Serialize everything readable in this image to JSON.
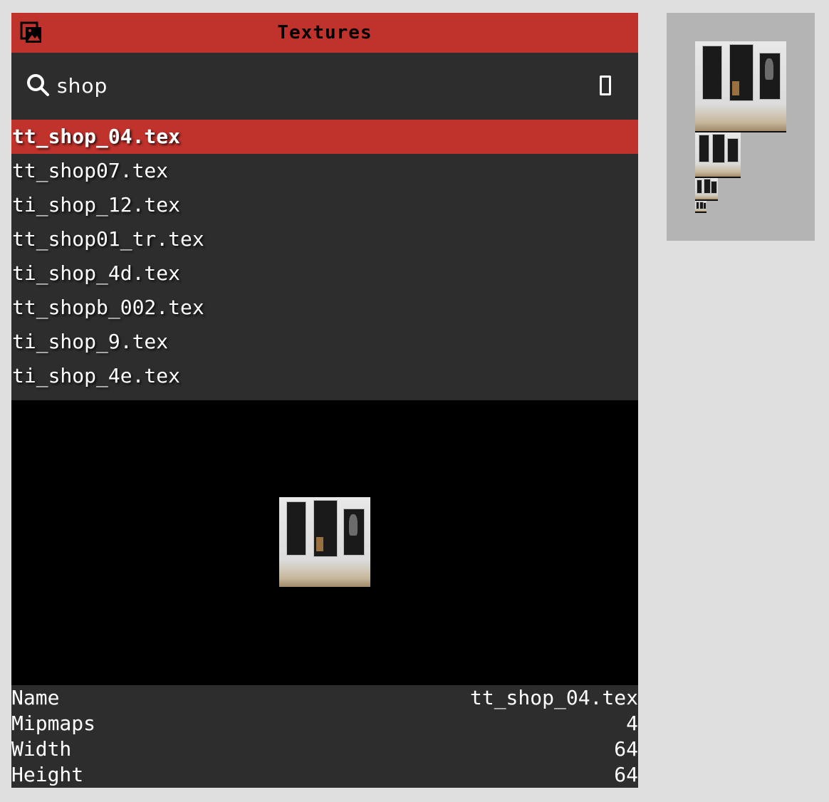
{
  "window": {
    "title": "Textures",
    "icon": "images-icon"
  },
  "search": {
    "value": "shop",
    "placeholder": "",
    "icon": "search-icon",
    "clear_icon": "clear-icon"
  },
  "texture_list": {
    "selected_index": 0,
    "items": [
      "tt_shop_04.tex",
      "tt_shop07.tex",
      "ti_shop_12.tex",
      "tt_shop01_tr.tex",
      "ti_shop_4d.tex",
      "tt_shopb_002.tex",
      "ti_shop_9.tex",
      "ti_shop_4e.tex"
    ]
  },
  "properties": [
    {
      "label": "Name",
      "value": "tt_shop_04.tex"
    },
    {
      "label": "Mipmaps",
      "value": "4"
    },
    {
      "label": "Width",
      "value": "64"
    },
    {
      "label": "Height",
      "value": "64"
    }
  ],
  "colors": {
    "accent": "#c0322c",
    "panel_bg": "#2d2d2d",
    "preview_bg": "#000000",
    "page_bg": "#dfdfdf",
    "mipmap_bg": "#b4b4b4"
  }
}
